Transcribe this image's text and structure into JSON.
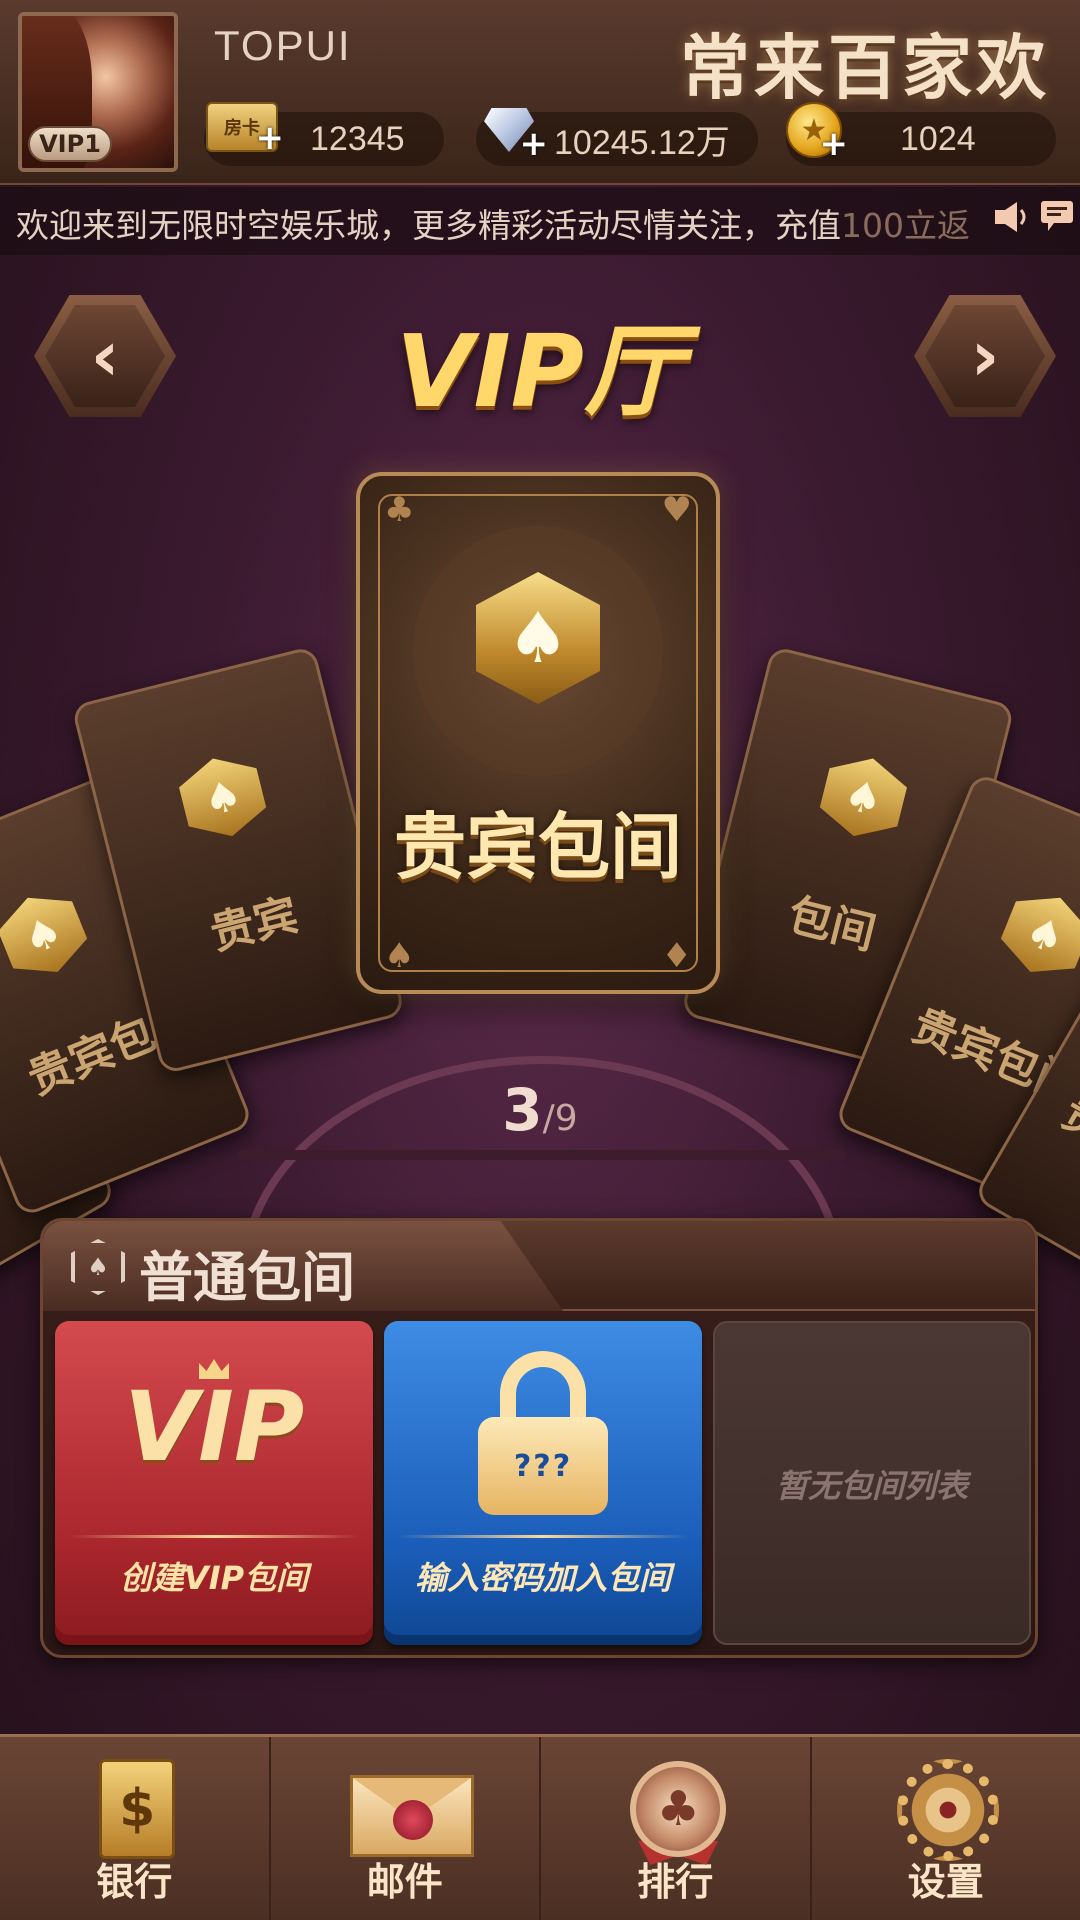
{
  "header": {
    "username": "TOPUI",
    "vip_level": "VIP1",
    "brand": "常来百家欢",
    "room_card_icon_text": "房卡",
    "room_cards": "12345",
    "diamonds": "10245.12万",
    "coins": "1024"
  },
  "marquee": {
    "text": "欢迎来到无限时空娱乐城，更多精彩活动尽情关注，充值",
    "text_fade": "100立返"
  },
  "hall": {
    "title": "VIP厅",
    "card_label": "贵宾包间",
    "side_card_label_short": "贵宾",
    "side_card_label_mid": "贵宾包",
    "side_card_label_right": "包间",
    "side_card_label_right2": "贵宾包间",
    "pager_current": "3",
    "pager_total": "/9"
  },
  "rooms": {
    "section_title": "普通包间",
    "create_vip_logo": "VIP",
    "create_vip_label": "创建VIP包间",
    "lock_code": "???",
    "join_label": "输入密码加入包间",
    "empty_label": "暂无包间列表"
  },
  "bottom_nav": {
    "bank": "银行",
    "mail": "邮件",
    "rank": "排行",
    "settings": "设置"
  },
  "colors": {
    "accent_gold": "#ffd76a",
    "red_button": "#a8262c",
    "blue_button": "#1a5db8"
  }
}
